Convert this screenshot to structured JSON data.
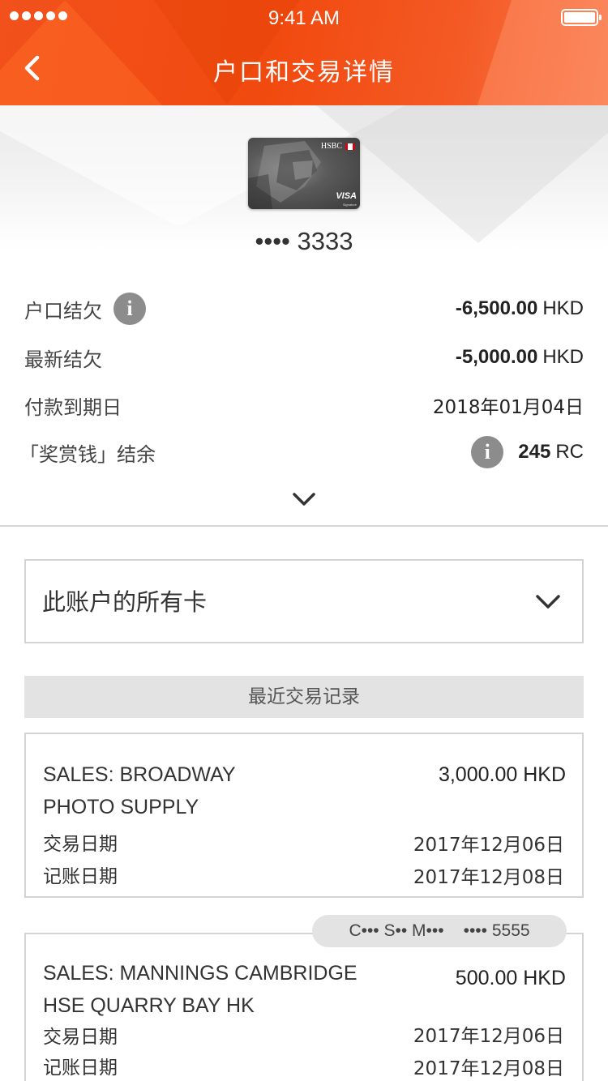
{
  "status_bar": {
    "time": "9:41 AM"
  },
  "header": {
    "title": "户口和交易详情"
  },
  "card": {
    "bank_name": "HSBC",
    "network": "VISA",
    "network_sub": "Signature",
    "masked_number": "•••• 3333"
  },
  "summary": {
    "balance_label": "户口结欠",
    "balance_amount": "-6,500.00",
    "balance_currency": "HKD",
    "latest_label": "最新结欠",
    "latest_amount": "-5,000.00",
    "latest_currency": "HKD",
    "due_label": "付款到期日",
    "due_date": "2018年01月04日",
    "rewards_label": "「奖赏钱」结余",
    "rewards_amount": "245",
    "rewards_unit": "RC"
  },
  "card_selector": {
    "label": "此账户的所有卡"
  },
  "recent_section": {
    "title": "最近交易记录"
  },
  "transactions": [
    {
      "merchant": "SALES: BROADWAY\nPHOTO SUPPLY",
      "amount": "3,000.00 HKD",
      "txn_date_label": "交易日期",
      "txn_date": "2017年12月06日",
      "post_date_label": "记账日期",
      "post_date": "2017年12月08日"
    },
    {
      "card_holder": "C••• S•• M•••",
      "card_number": "•••• 5555",
      "merchant": "SALES: MANNINGS CAMBRIDGE\nHSE QUARRY BAY HK",
      "amount": "500.00 HKD",
      "txn_date_label": "交易日期",
      "txn_date": "2017年12月06日",
      "post_date_label": "记账日期",
      "post_date": "2017年12月08日"
    }
  ],
  "icons": {
    "back": "chevron-left-icon",
    "info": "info-icon",
    "expand": "chevron-down-icon"
  },
  "colors": {
    "header_accent": "#f2511c",
    "info_icon": "#8c8c8c",
    "section_bar": "#e3e3e3"
  }
}
